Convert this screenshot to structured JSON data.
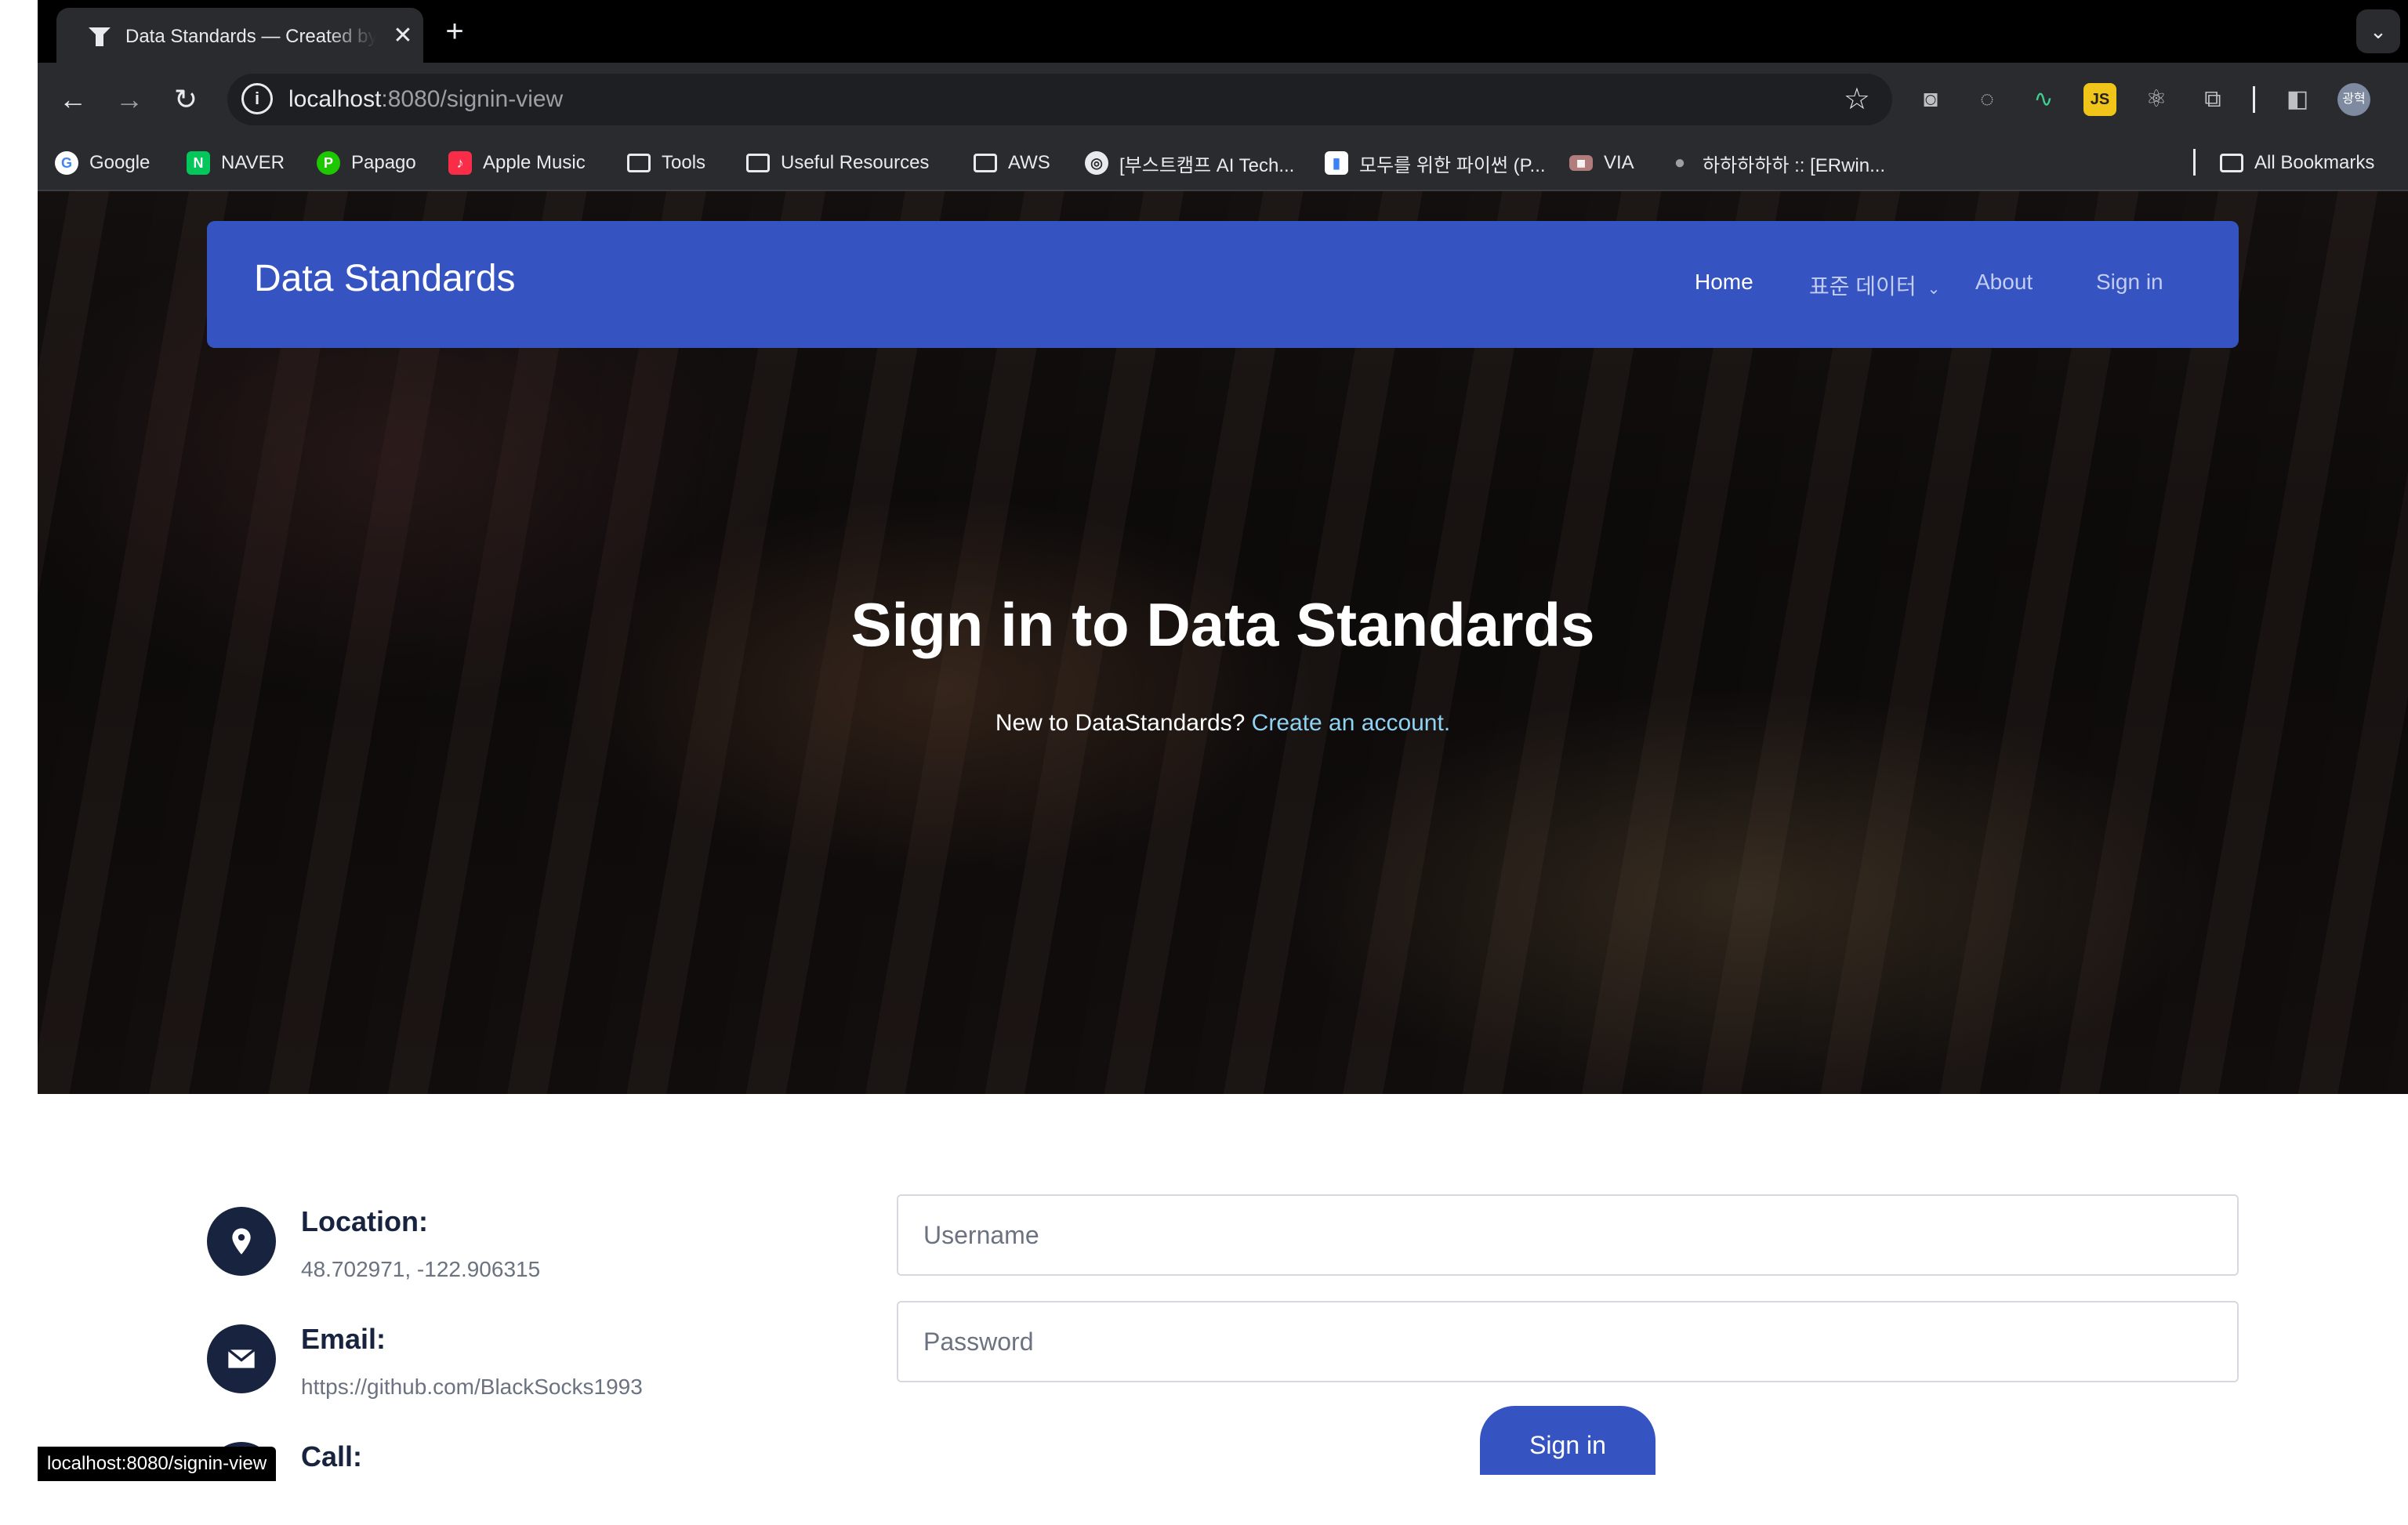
{
  "browser": {
    "tab_title": "Data Standards — Created by",
    "url_host": "localhost",
    "url_rest": ":8080/signin-view",
    "status_url": "localhost:8080/signin-view",
    "bookmarks": [
      "Google",
      "NAVER",
      "Papago",
      "Apple Music",
      "Tools",
      "Useful Resources",
      "AWS",
      "[부스트캠프 AI Tech...",
      "모두를 위한 파이썬 (P...",
      "VIA",
      "하하하하하 :: [ERwin..."
    ],
    "all_bookmarks": "All Bookmarks",
    "profile_initials": "광혁"
  },
  "navbar": {
    "brand": "Data Standards",
    "home": "Home",
    "standard_data": "표준 데이터",
    "about": "About",
    "sign_in": "Sign in"
  },
  "hero": {
    "title": "Sign in to Data Standards",
    "prompt": "New to DataStandards?",
    "link": "Create an account."
  },
  "contact": {
    "location_label": "Location:",
    "location_value": "48.702971, -122.906315",
    "email_label": "Email:",
    "email_value": "https://github.com/BlackSocks1993",
    "call_label": "Call:"
  },
  "form": {
    "username_placeholder": "Username",
    "password_placeholder": "Password",
    "submit": "Sign in"
  },
  "colors": {
    "brand_blue": "#3553c1",
    "dark_navy": "#17233f",
    "link_cyan": "#8fd3f4"
  }
}
